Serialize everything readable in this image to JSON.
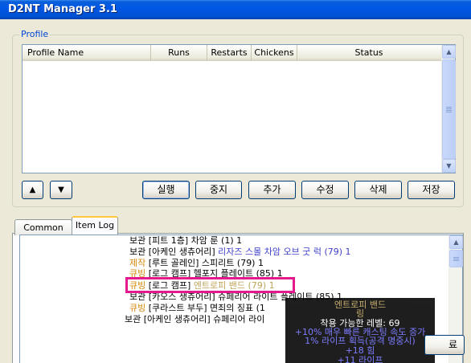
{
  "window": {
    "title": "D2NT Manager 3.1"
  },
  "profile": {
    "group_label": "Profile",
    "columns": [
      "Profile Name",
      "Runs",
      "Restarts",
      "Chickens",
      "Status"
    ],
    "up_arrow": "▲",
    "down_arrow": "▼",
    "buttons": {
      "run": "실행",
      "stop": "중지",
      "add": "추가",
      "edit": "수정",
      "delete": "삭제",
      "save": "저장"
    }
  },
  "tabs": {
    "common_log": "Common Log",
    "item_log": "Item Log"
  },
  "item_log": [
    {
      "prefix": "보관 [피트 1층] 차암 룬 (1) 1",
      "name": "",
      "suffix": ""
    },
    {
      "prefix": "보관 [아케인 생츄어리] ",
      "name": "리자즈 스몰 차암 오브 굿 럭 (79) 1",
      "suffix": ""
    },
    {
      "prefix": "제작",
      "name": " [루트 골레인] 스피리트 (79) 1",
      "suffix": ""
    },
    {
      "prefix": "큐빙",
      "name": " [로그 캠프] 헬포지 플레이트 (85) 1",
      "suffix": ""
    },
    {
      "prefix": "큐빙",
      "name": " [로그 캠프] ",
      "suffix": "엔트로피 밴드 (79) 1"
    },
    {
      "prefix": "보관 [카오스 생츄어리] 슈페리어 라이트 플레이트 (85) 1",
      "name": "",
      "suffix": ""
    },
    {
      "prefix": "큐빙",
      "name": " [쿠라스트 부두] 면죄의 징표 (1",
      "suffix": ""
    },
    {
      "prefix": "보관 [아케인 생츄어리] 슈페리어 라이",
      "name": "",
      "suffix": ""
    }
  ],
  "tooltip": {
    "name": "엔트로피 밴드",
    "type": "링",
    "req_level": "착용 가능한 레벨: 69",
    "mods": [
      "+10% 매우 빠른 캐스팅 속도 증가",
      "1% 라이프 획득(공격 명중시)",
      "+18 힘",
      "+11 라이프"
    ]
  },
  "finish_button": "료",
  "colors": {
    "highlight": "#E5198E",
    "set_item": "#1EAA1E",
    "unique_item": "#BFA35A",
    "magic_item": "#3F3FCC",
    "crafted": "#D68A10"
  }
}
